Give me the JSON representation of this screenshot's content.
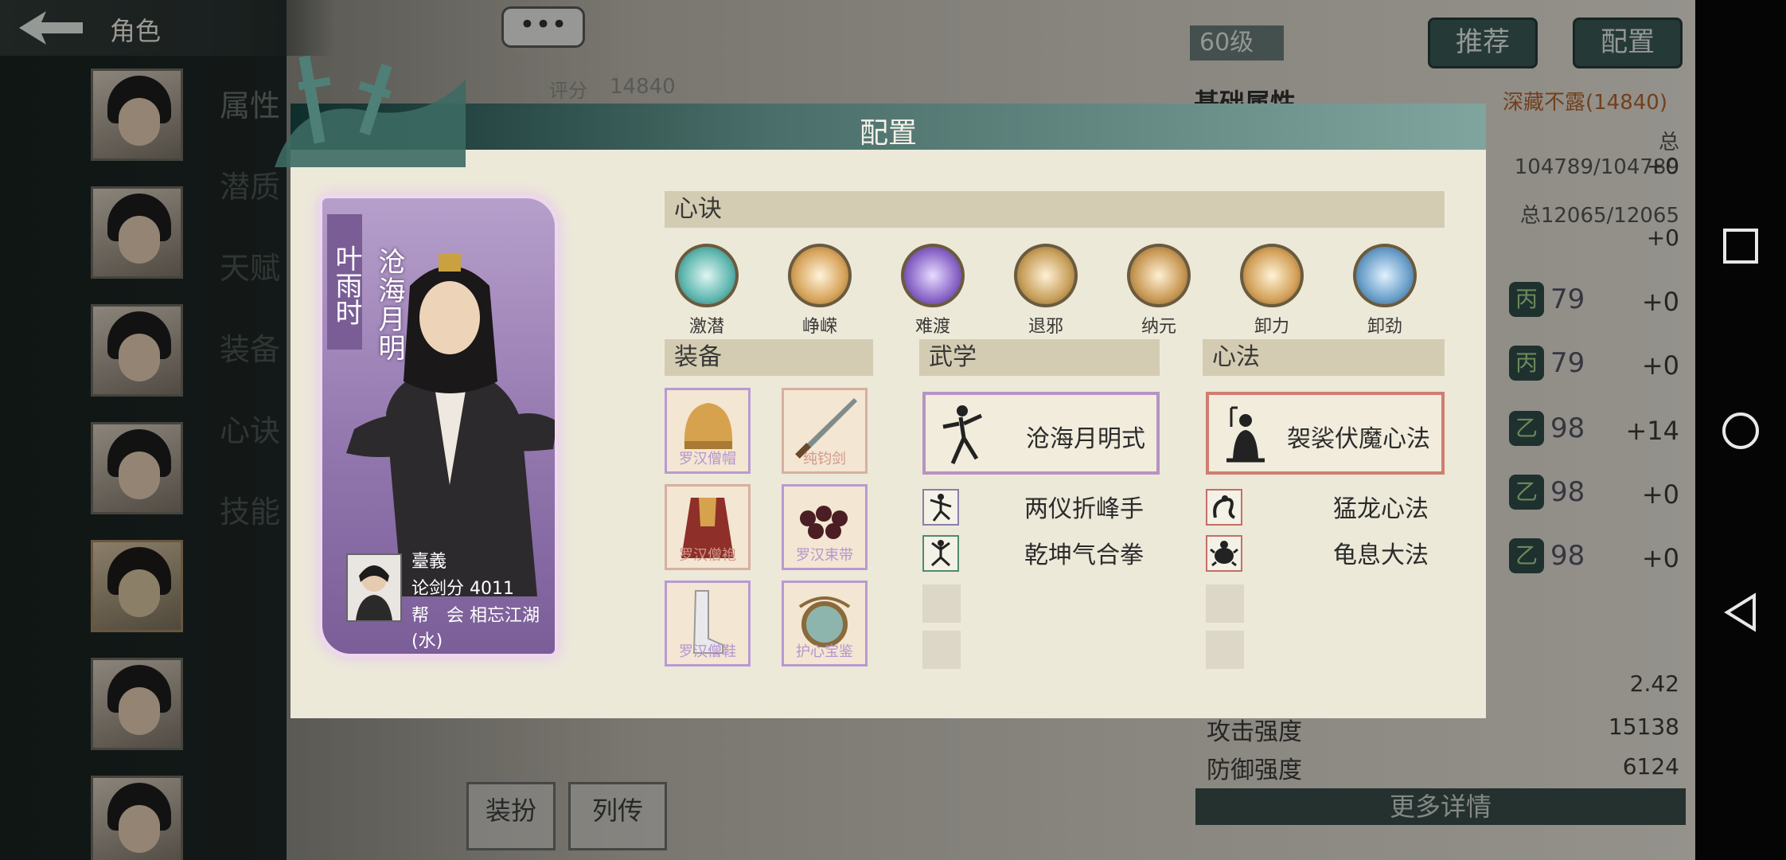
{
  "header": {
    "title": "角色",
    "chat_label": "•••"
  },
  "side_tabs": [
    "属性",
    "潜质",
    "天赋",
    "装备",
    "心诀",
    "技能"
  ],
  "top_right": {
    "level": "60级",
    "recommend_label": "推荐",
    "config_label": "配置"
  },
  "score": {
    "label": "评分",
    "value": "14840"
  },
  "stats": {
    "base_attr": "基础属性",
    "hidden_title": "深藏不露(14840)",
    "total_hp": "总104789/104789",
    "total_mp": "总12065/12065",
    "rows": [
      {
        "badge": "丙",
        "value": "79",
        "delta": "+0"
      },
      {
        "badge": "丙",
        "value": "79",
        "delta": "+0"
      },
      {
        "badge": "乙",
        "value": "98",
        "delta": "+14"
      },
      {
        "badge": "乙",
        "value": "98",
        "delta": "+0"
      },
      {
        "badge": "乙",
        "value": "98",
        "delta": "+0"
      }
    ],
    "plus_top": [
      "+0",
      "+0"
    ],
    "crit": "2.42",
    "attack_label": "攻击强度",
    "attack_value": "15138",
    "defense_label": "防御强度",
    "defense_value": "6124",
    "more_label": "更多详情"
  },
  "bottom_buttons": [
    "装扮",
    "列传"
  ],
  "dialog": {
    "title": "配置",
    "character": {
      "name": "叶雨时",
      "style_title": "沧海月明",
      "player_name": "臺義",
      "pvp_score_label": "论剑分",
      "pvp_score": "4011",
      "guild_label": "帮　会",
      "guild": "相忘江湖(水)"
    },
    "xinjue": {
      "heading": "心诀",
      "items": [
        "激潜",
        "峥嵘",
        "难渡",
        "退邪",
        "纳元",
        "卸力",
        "卸劲"
      ],
      "colors": [
        "#5fb7b0",
        "#d8a55d",
        "#8a66c8",
        "#c8a05b",
        "#c99a56",
        "#d4a25a",
        "#6a9fc9"
      ]
    },
    "equipment": {
      "heading": "装备",
      "items": [
        "罗汉僧帽",
        "纯钧剑",
        "罗汉僧袍",
        "罗汉束带",
        "罗汉僧鞋",
        "护心宝鉴"
      ]
    },
    "martial": {
      "heading": "武学",
      "main": "沧海月明式",
      "skills": [
        "两仪折峰手",
        "乾坤气合拳"
      ]
    },
    "heart_method": {
      "heading": "心法",
      "main": "袈裟伏魔心法",
      "skills": [
        "猛龙心法",
        "龟息大法"
      ]
    }
  }
}
